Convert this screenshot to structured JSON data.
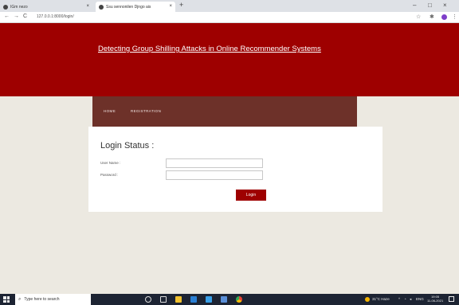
{
  "browser": {
    "tabs": [
      {
        "title": "IGm nezo"
      },
      {
        "title": "Ssu sennonilen Djngo ais"
      }
    ],
    "new_tab": "+",
    "url": "127.0.0.1:8000/login/",
    "window_controls": {
      "minimize": "–",
      "restore": "□",
      "close": "×"
    },
    "nav": {
      "back": "←",
      "forward": "→",
      "reload": "C"
    }
  },
  "site": {
    "title": "Detecting Group Shilling Attacks in Online Recommender Systems",
    "nav": [
      "HOME",
      "REGISTRATION"
    ]
  },
  "login": {
    "title": "Login Status :",
    "username_label": "User Name :",
    "password_label": "Password :",
    "username_value": "",
    "password_value": "",
    "button": "Login"
  },
  "taskbar": {
    "search_placeholder": "Type here to search",
    "weather": "31°C Haze",
    "lang": "ENG",
    "time": "19:05",
    "date": "11-06-2021"
  },
  "colors": {
    "header": "#9e0000",
    "navbar": "#6d3129",
    "page_bg": "#ece9e1",
    "button": "#9e0000"
  }
}
